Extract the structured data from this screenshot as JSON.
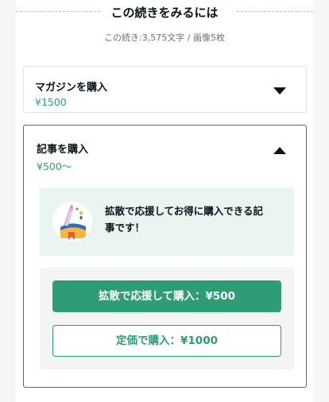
{
  "section": {
    "title": "この続きをみるには",
    "meta": "この続き:3,575文字 / 画像5枚"
  },
  "magazine": {
    "title": "マガジンを購入",
    "price": "¥1500",
    "toggle_icon": "caret-down-icon"
  },
  "article": {
    "title": "記事を購入",
    "price": "¥500〜",
    "toggle_icon": "caret-up-icon",
    "promo_text": "拡散で応援してお得に購入できる記事です！",
    "promo_icon": "party-popper-icon",
    "primary_button": "拡散で応援して購入：¥500",
    "secondary_button": "定価で購入：¥1000"
  },
  "colors": {
    "accent": "#2e9d73",
    "promo_bg": "#e8f5f1",
    "panel_bg": "#f3f4f4"
  }
}
